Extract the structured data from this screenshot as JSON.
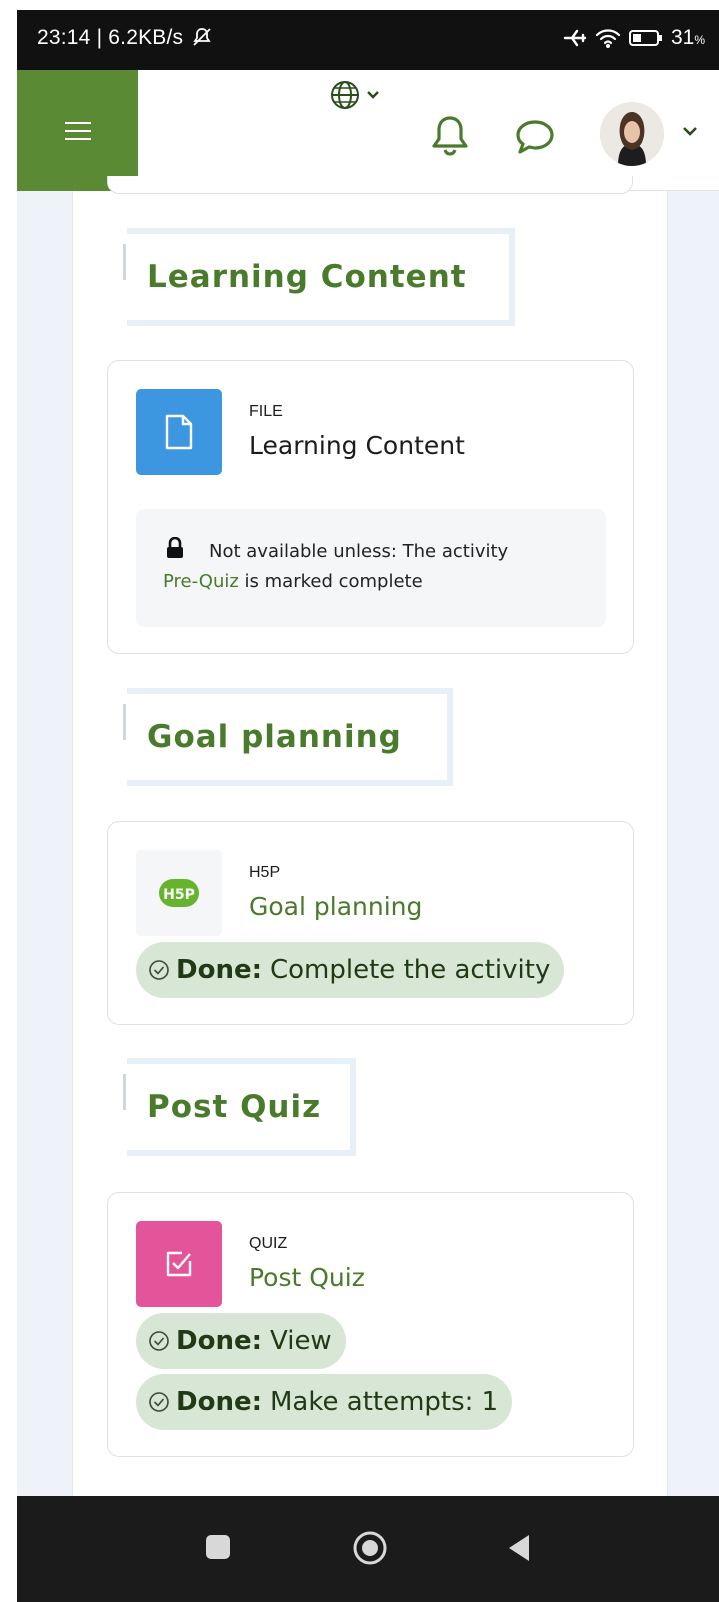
{
  "status_bar": {
    "time_speed": "23:14 | 6.2KB/s",
    "battery": "31",
    "battery_unit": "%"
  },
  "header": {
    "menu_icon": "hamburger-icon",
    "language_icon": "globe-icon",
    "notifications_icon": "bell-icon",
    "messages_icon": "chat-icon",
    "user_avatar": "avatar"
  },
  "sections": [
    {
      "title": "Learning Content",
      "activity": {
        "type": "FILE",
        "name": "Learning Content",
        "icon": "file-icon",
        "restriction": {
          "prefix": "Not available unless: The activity",
          "link": "Pre-Quiz",
          "suffix": "is marked complete"
        }
      }
    },
    {
      "title": "Goal planning",
      "activity": {
        "type": "H5P",
        "name": "Goal planning",
        "icon": "h5p-icon",
        "icon_text": "H5P",
        "completion": [
          {
            "status": "Done:",
            "text": "Complete the activity"
          }
        ]
      }
    },
    {
      "title": "Post Quiz",
      "activity": {
        "type": "QUIZ",
        "name": "Post Quiz",
        "icon": "quiz-icon",
        "completion": [
          {
            "status": "Done:",
            "text": "View"
          },
          {
            "status": "Done:",
            "text": "Make attempts: 1"
          }
        ]
      }
    }
  ],
  "colors": {
    "brand_green": "#5b8a35",
    "link_green": "#4a7a2b",
    "file_blue": "#3c97e0",
    "quiz_pink": "#e4549a",
    "done_bg": "#d8e6d5"
  }
}
